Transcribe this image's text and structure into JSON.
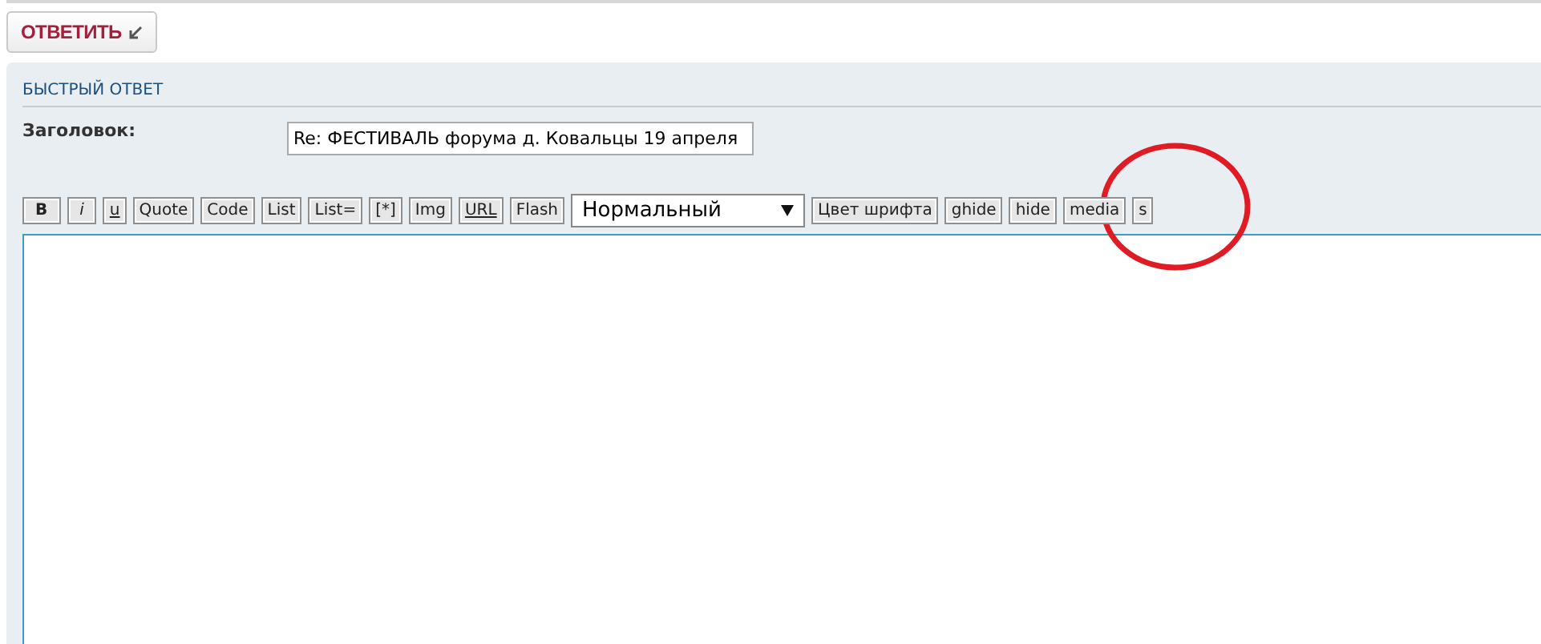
{
  "reply_button": {
    "label": "ОТВЕТИТЬ"
  },
  "quick_reply": {
    "title": "БЫСТРЫЙ ОТВЕТ",
    "subject_label": "Заголовок:",
    "subject_value": "Re: ФЕСТИВАЛЬ форума д. Ковальцы 19 апреля",
    "toolbar": [
      {
        "kind": "bold",
        "label": "B"
      },
      {
        "kind": "italic",
        "label": "i"
      },
      {
        "kind": "underline",
        "label": "u"
      },
      {
        "kind": "plain",
        "label": "Quote"
      },
      {
        "kind": "plain",
        "label": "Code"
      },
      {
        "kind": "plain",
        "label": "List"
      },
      {
        "kind": "plain",
        "label": "List="
      },
      {
        "kind": "plain",
        "label": "[*]"
      },
      {
        "kind": "plain",
        "label": "Img"
      },
      {
        "kind": "underline",
        "label": "URL"
      },
      {
        "kind": "plain",
        "label": "Flash"
      },
      {
        "kind": "select",
        "label": "Нормальный"
      },
      {
        "kind": "plain",
        "label": "Цвет шрифта"
      },
      {
        "kind": "plain",
        "label": "ghide"
      },
      {
        "kind": "plain",
        "label": "hide"
      },
      {
        "kind": "plain",
        "label": "media"
      },
      {
        "kind": "plain",
        "label": "s"
      }
    ]
  }
}
